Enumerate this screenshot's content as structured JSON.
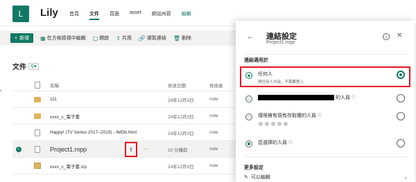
{
  "site": {
    "logo_letter": "L",
    "name": "Lily",
    "nav": [
      "首頁",
      "文件",
      "頁面",
      "asset",
      "網站內容",
      "編輯"
    ]
  },
  "commandbar": {
    "new": "新增",
    "grid_edit": "在方格檢視中編輯",
    "open": "開啟",
    "share": "共用",
    "copy_link": "複製連結",
    "delete": "刪除"
  },
  "library": {
    "title": "文件",
    "view_icon": "view-icon"
  },
  "list": {
    "headers": {
      "name": "名稱",
      "modified": "修改日期",
      "modified_by": "修改者"
    },
    "rows": [
      {
        "name": "111",
        "modified": "24年12月3日",
        "by": "note",
        "type": "folder"
      },
      {
        "name": "xxxx_c_電子書",
        "modified": "24年12月3日",
        "by": "note",
        "type": "folder"
      },
      {
        "name": "Happy! (TV Series 2017–2019) - IMDb.html",
        "modified": "24年12月3日",
        "by": "note",
        "type": "file"
      },
      {
        "name": "Project1.mpp",
        "modified": "10 分鐘前",
        "by": "note",
        "type": "file"
      },
      {
        "name": "xxxx_c_電子書.zip",
        "modified": "24年12月3日",
        "by": "note",
        "type": "zip"
      }
    ]
  },
  "panel": {
    "title": "連結設定",
    "file": "Project1.mpp",
    "section": "連結適用於",
    "options": [
      {
        "label": "任何人",
        "desc": "與任何人共用，不需要登入"
      },
      {
        "label": "的人員"
      },
      {
        "label": "僅限擁有現有存取權的人員"
      },
      {
        "label": "您選擇的人員"
      }
    ],
    "more": "更多設定",
    "permission": "可以編輯"
  }
}
